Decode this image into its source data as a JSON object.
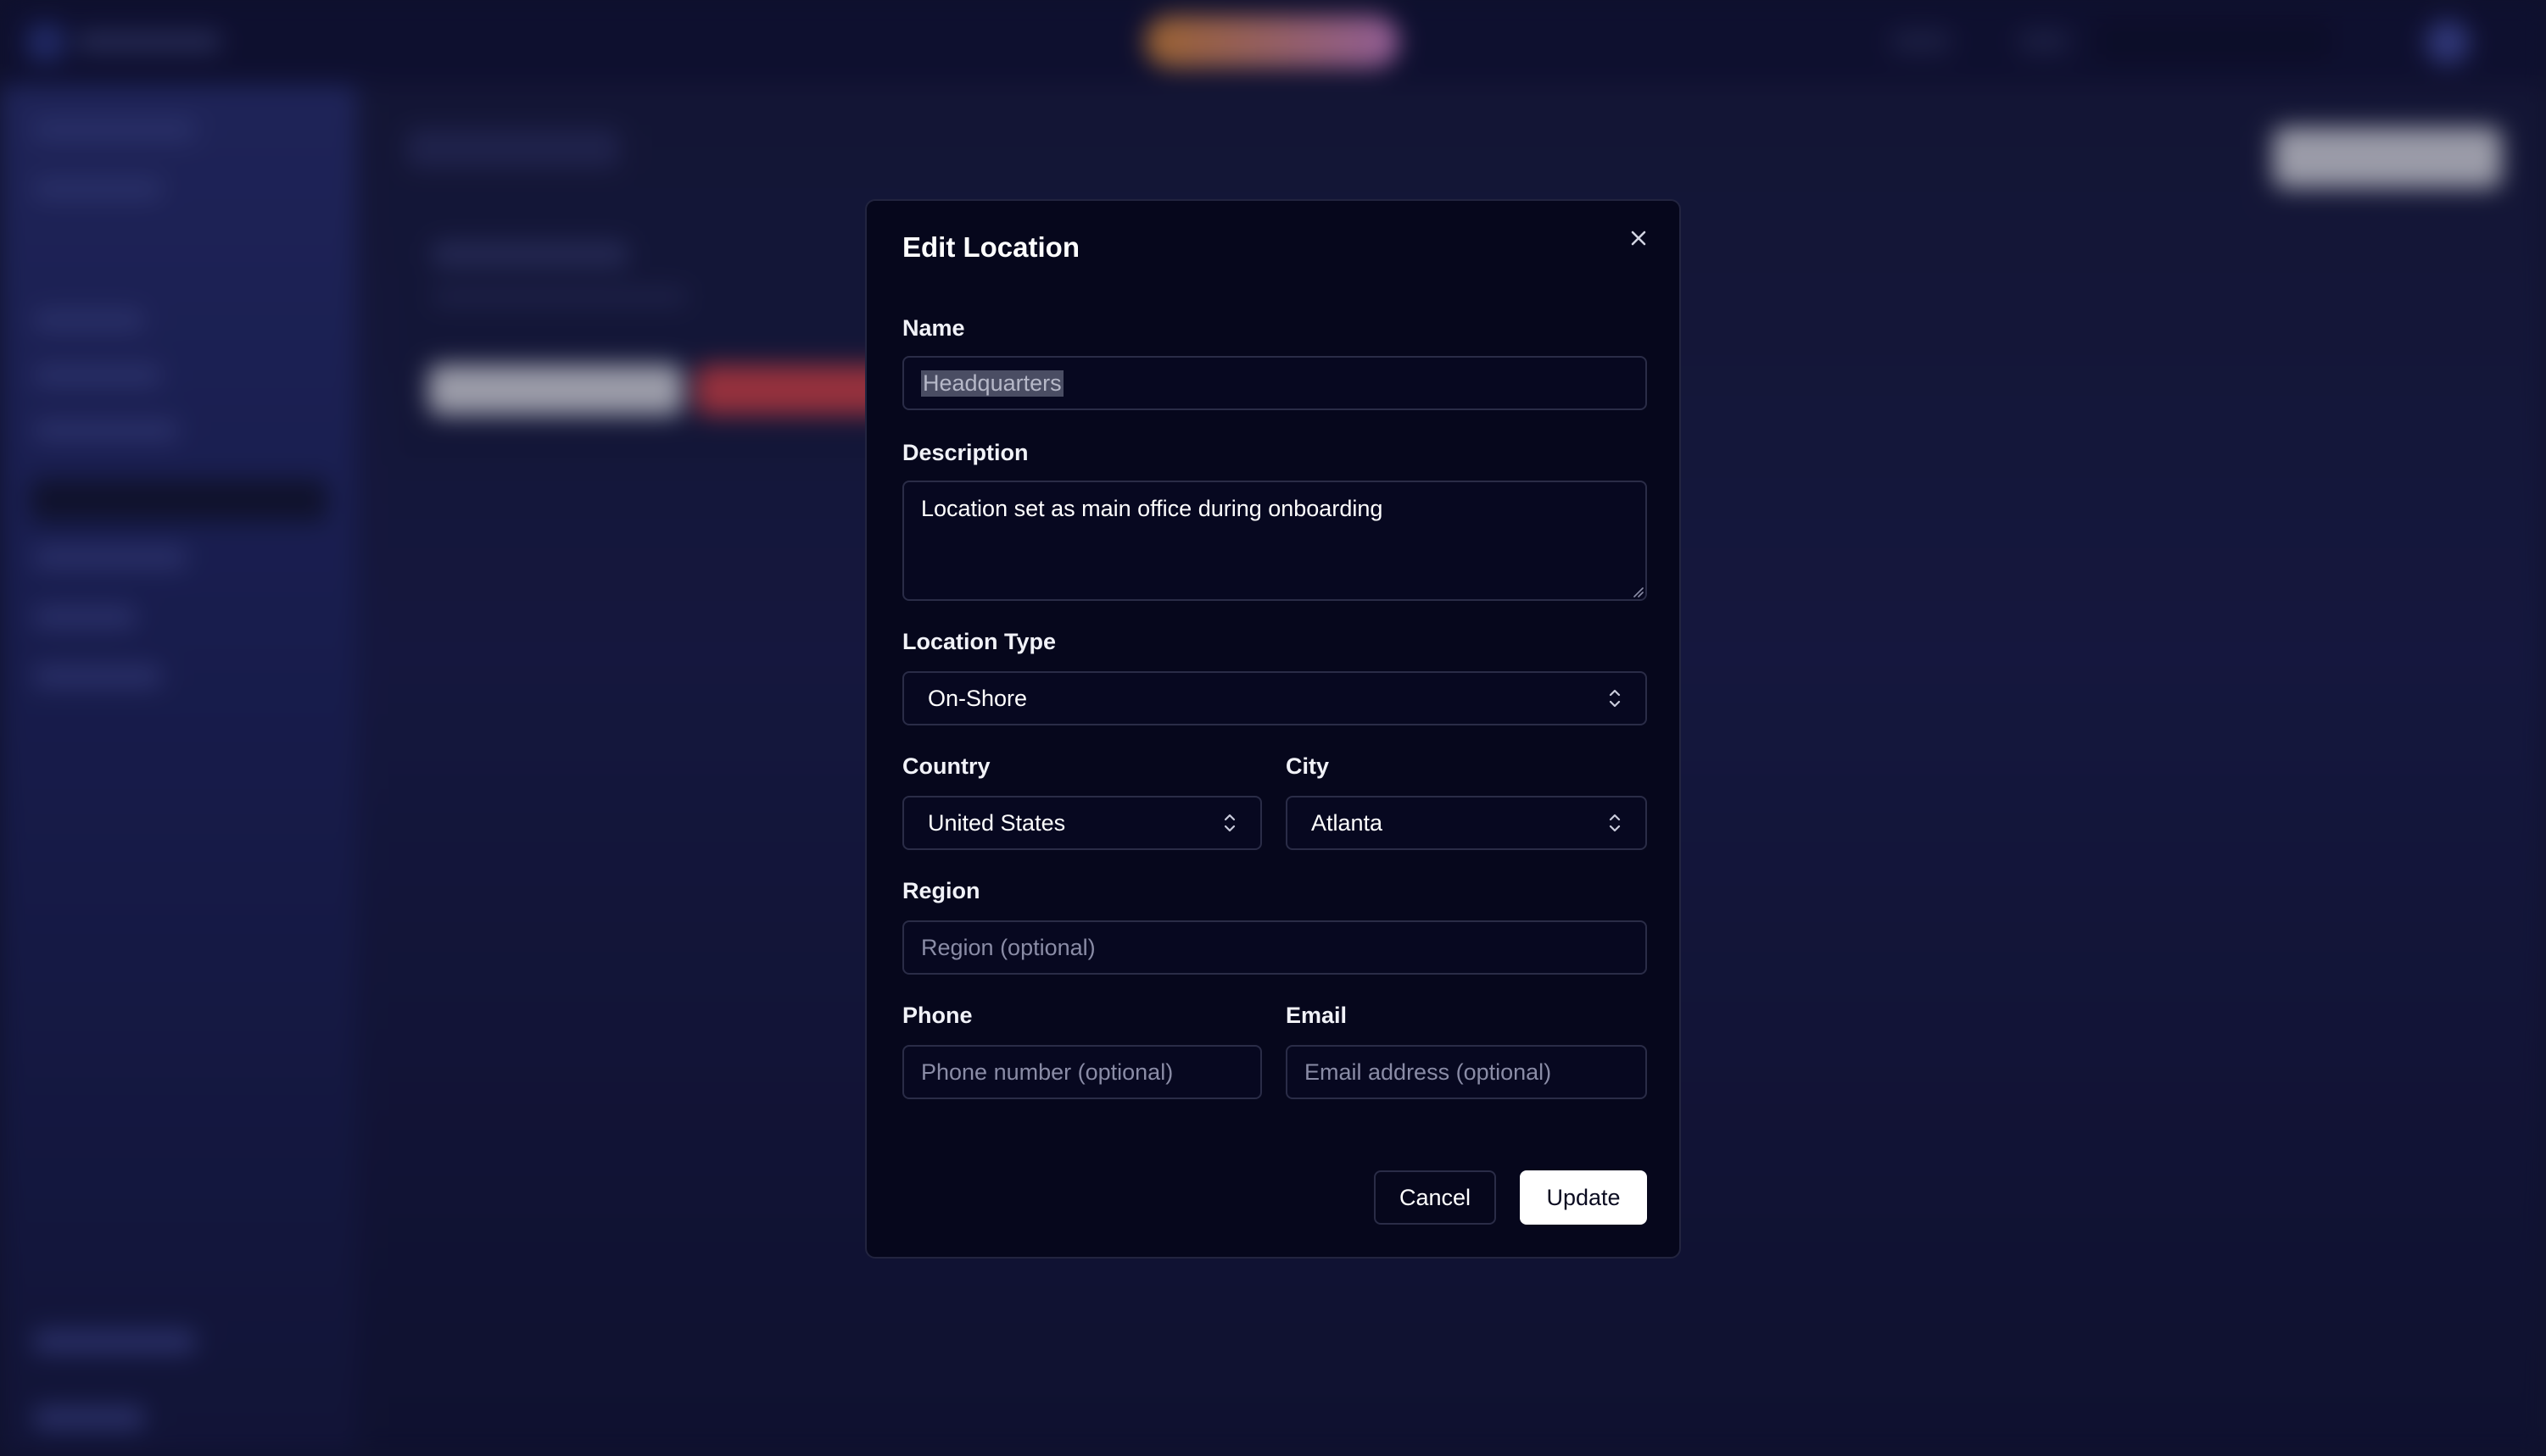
{
  "modal": {
    "title": "Edit Location",
    "name": {
      "label": "Name",
      "value": "Headquarters"
    },
    "description": {
      "label": "Description",
      "value": "Location set as main office during onboarding"
    },
    "location_type": {
      "label": "Location Type",
      "value": "On-Shore"
    },
    "country": {
      "label": "Country",
      "value": "United States"
    },
    "city": {
      "label": "City",
      "value": "Atlanta"
    },
    "region": {
      "label": "Region",
      "value": "",
      "placeholder": "Region (optional)"
    },
    "phone": {
      "label": "Phone",
      "value": "",
      "placeholder": "Phone number (optional)"
    },
    "email": {
      "label": "Email",
      "value": "",
      "placeholder": "Email address (optional)"
    },
    "cancel_label": "Cancel",
    "update_label": "Update"
  },
  "icons": {
    "close": "close-icon",
    "select_chevron": "chevron-up-down-icon"
  },
  "colors": {
    "modal_bg": "#06071c",
    "field_border": "#2a2c47",
    "primary_button": "#ffffff",
    "placeholder": "#8a8ca6"
  }
}
